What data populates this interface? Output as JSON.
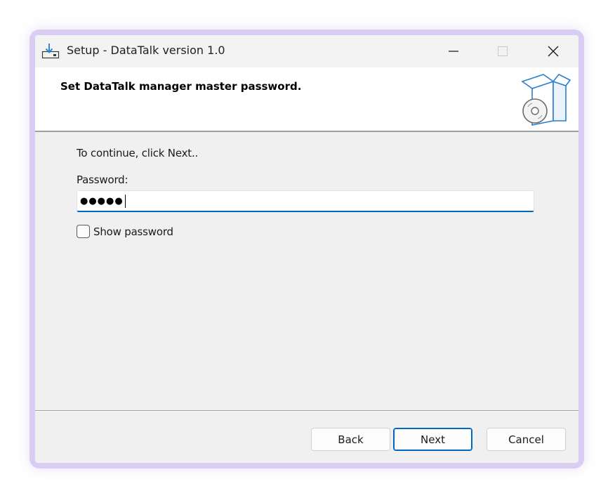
{
  "window": {
    "title": "Setup - DataTalk version 1.0",
    "controls": {
      "minimize_glyph": "—",
      "maximize_glyph": "☐",
      "close_glyph": "✕"
    },
    "title_icon": "setup-download-icon"
  },
  "header": {
    "title": "Set DataTalk manager master password.",
    "icon": "software-box-disc-icon"
  },
  "content": {
    "instructions": "To continue, click Next..",
    "password_label": "Password:",
    "password_value": "●●●●●",
    "show_password_label": "Show password",
    "show_password_checked": false
  },
  "footer": {
    "back_label": "Back",
    "next_label": "Next",
    "cancel_label": "Cancel"
  },
  "colors": {
    "accent": "#0067c0",
    "frame": "#d9cdf3",
    "window_bg": "#f0f0f0",
    "header_bg": "#ffffff"
  }
}
